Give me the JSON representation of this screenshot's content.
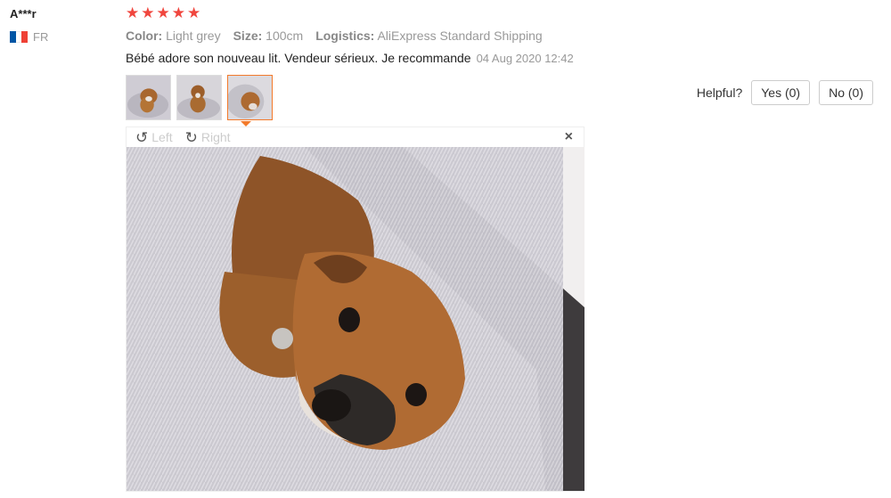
{
  "reviewer": {
    "name": "A***r",
    "country": "FR",
    "flag_colors": [
      "#0055a4",
      "#ffffff",
      "#ef4135"
    ]
  },
  "rating": {
    "stars": 5,
    "star_color": "#f0463e",
    "star_glyph": "★"
  },
  "attributes": [
    {
      "key": "Color:",
      "value": "Light grey"
    },
    {
      "key": "Size:",
      "value": "100cm"
    },
    {
      "key": "Logistics:",
      "value": "AliExpress Standard Shipping"
    }
  ],
  "review": {
    "text": "Bébé adore son nouveau lit. Vendeur sérieux. Je recommande",
    "date": "04 Aug 2020 12:42"
  },
  "photos": {
    "count": 3,
    "active_index": 2
  },
  "helpful": {
    "label": "Helpful?",
    "yes_label": "Yes (0)",
    "no_label": "No (0)"
  },
  "viewer": {
    "rotate_left_label": "Left",
    "rotate_right_label": "Right",
    "rotate_left_icon": "rotate-left-icon",
    "rotate_right_icon": "rotate-right-icon",
    "close_glyph": "×"
  },
  "colors": {
    "accent": "#f37a2b"
  }
}
